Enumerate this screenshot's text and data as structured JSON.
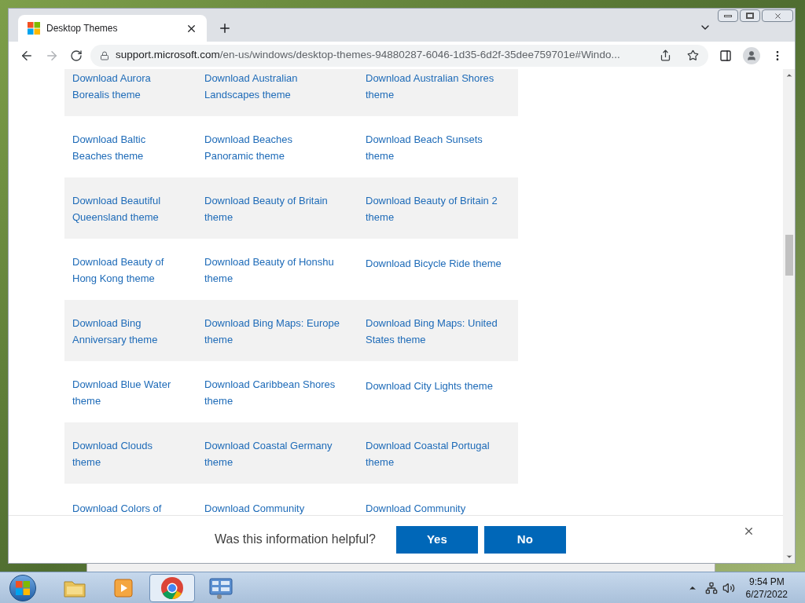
{
  "browser": {
    "tab": {
      "title": "Desktop Themes"
    },
    "url": {
      "host": "support.microsoft.com",
      "path": "/en-us/windows/desktop-themes-94880287-6046-1d35-6d2f-35dee759701e#Windo..."
    }
  },
  "themes": {
    "rows": [
      {
        "cells": [
          "Download Aurora Borealis theme",
          "Download Australian Landscapes theme",
          "Download Australian Shores theme"
        ]
      },
      {
        "cells": [
          "Download Baltic Beaches theme",
          "Download Beaches Panoramic theme",
          "Download Beach Sunsets theme"
        ]
      },
      {
        "cells": [
          "Download Beautiful Queensland theme",
          "Download Beauty of Britain theme",
          "Download Beauty of Britain 2 theme"
        ]
      },
      {
        "cells": [
          "Download Beauty of Hong Kong theme",
          "Download Beauty of Honshu theme",
          "Download Bicycle Ride theme"
        ]
      },
      {
        "cells": [
          "Download Bing Anniversary theme",
          "Download Bing Maps: Europe theme",
          "Download Bing Maps: United States theme"
        ]
      },
      {
        "cells": [
          "Download Blue Water theme",
          "Download Caribbean Shores theme",
          "Download City Lights theme"
        ]
      },
      {
        "cells": [
          "Download Clouds theme",
          "Download Coastal Germany theme",
          "Download Coastal Portugal theme"
        ]
      },
      {
        "cells": [
          "Download Colors of",
          "Download Community",
          "Download Community"
        ]
      }
    ]
  },
  "feedback": {
    "question": "Was this information helpful?",
    "buttons": [
      "Yes",
      "No"
    ]
  },
  "taskbar": {
    "apps": [
      {
        "kind": "folder",
        "selected": false
      },
      {
        "kind": "media",
        "selected": false
      },
      {
        "kind": "chrome",
        "selected": true
      },
      {
        "kind": "panel",
        "selected": false
      }
    ],
    "clock": {
      "time": "9:54 PM",
      "date": "6/27/2022"
    }
  }
}
